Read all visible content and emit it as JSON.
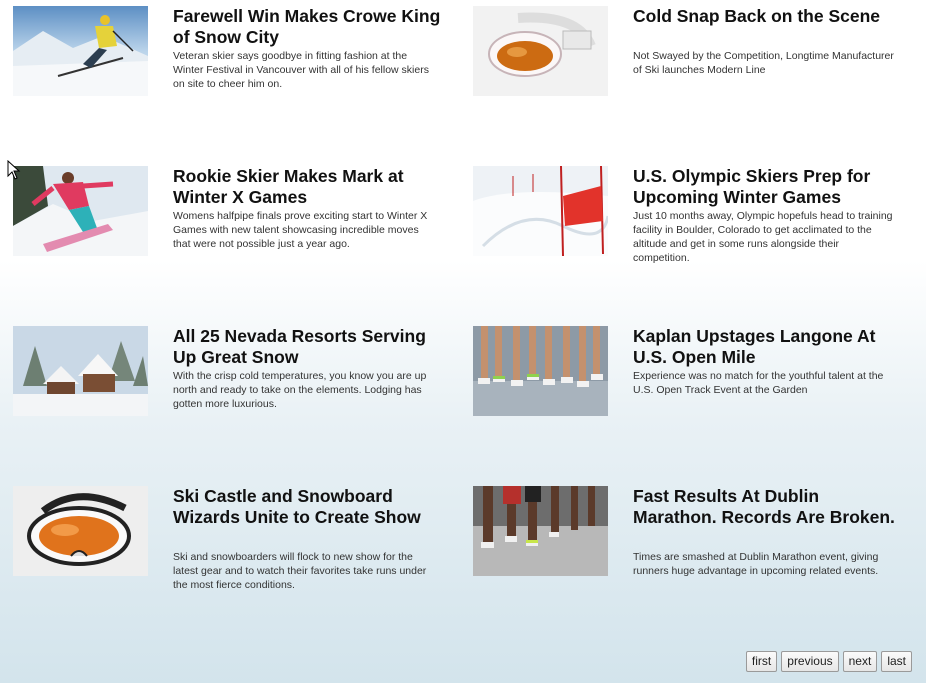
{
  "articles": [
    {
      "title": "Farewell Win Makes Crowe King of Snow City",
      "description": "Veteran skier says goodbye in fitting fashion at the Winter Festival in Vancouver with all of his fellow skiers on site to cheer him on.",
      "thumb": "skier-downhill"
    },
    {
      "title": "Cold Snap Back on the Scene",
      "description": "Not Swayed by the Competition, Longtime Manufacturer of Ski launches Modern Line",
      "thumb": "ski-goggles-white"
    },
    {
      "title": "Rookie Skier Makes Mark at Winter X Games",
      "description": "Womens halfpipe finals prove exciting start to Winter X Games with new talent showcasing incredible moves that were not possible just a year ago.",
      "thumb": "snowboarder"
    },
    {
      "title": "U.S. Olympic Skiers Prep for Upcoming Winter Games",
      "description": "Just 10 months away, Olympic hopefuls head to training facility in Boulder, Colorado to get acclimated to the altitude and get in some runs alongside their competition.",
      "thumb": "slalom-gates"
    },
    {
      "title": "All 25 Nevada Resorts Serving Up Great Snow",
      "description": "With the crisp cold temperatures, you know you are up north and ready to take on the elements. Lodging has gotten more luxurious.",
      "thumb": "snowy-cabins"
    },
    {
      "title": "Kaplan Upstages Langone At U.S. Open Mile",
      "description": "Experience was no match for the youthful talent at the U.S. Open Track Event at the Garden",
      "thumb": "runners-legs"
    },
    {
      "title": "Ski Castle and Snowboard Wizards Unite to Create Show",
      "description": "Ski and snowboarders will flock to new show for the latest gear and to watch their favorites take runs under the most fierce conditions.",
      "thumb": "ski-goggles-orange"
    },
    {
      "title": "Fast Results At Dublin Marathon. Records Are Broken.",
      "description": "Times are smashed at Dublin Marathon event, giving runners huge advantage in upcoming related events.",
      "thumb": "marathon-runners"
    }
  ],
  "pager": {
    "first": "first",
    "previous": "previous",
    "next": "next",
    "last": "last"
  }
}
